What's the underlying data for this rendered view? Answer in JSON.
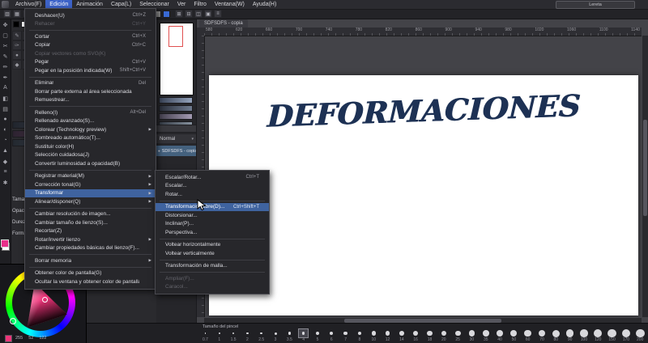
{
  "menubar": {
    "items": [
      {
        "label": "Archivo(F)"
      },
      {
        "label": "Edición",
        "active": true
      },
      {
        "label": "Animación"
      },
      {
        "label": "Capa(L)"
      },
      {
        "label": "Seleccionar"
      },
      {
        "label": "Ver"
      },
      {
        "label": "Filtro"
      },
      {
        "label": "Ventana(W)"
      },
      {
        "label": "Ayuda(H)"
      }
    ]
  },
  "window_badge": {
    "label": "Lereta"
  },
  "toolbar": {
    "left_icons": [
      "▥",
      "▦",
      "↶",
      "↷",
      "✚",
      "✖"
    ],
    "colors": [
      "#e8308a",
      "#00b7c3",
      "#2b3a8f",
      "#19a15f",
      "#c3d22b",
      "#e8a13a",
      "#d23b2f",
      "#111111",
      "#f2f2f2",
      "#7a4fd0",
      "#888888",
      "#3a6ad4"
    ],
    "right_icons": [
      "⊞",
      "⊟",
      "◫",
      "▣",
      "≡"
    ]
  },
  "tool_strip": {
    "icons": [
      "✥",
      "▢",
      "✂",
      "✎",
      "✏",
      "✒",
      "A",
      "◧",
      "▤",
      "●",
      "◐",
      "◔",
      "▲",
      "◆",
      "≡",
      "✱"
    ],
    "fg_color": "#e8308a",
    "bg_color": "#ffffff"
  },
  "palette_chips": [
    "#000000",
    "#ffffff",
    "#e8308a",
    "#5b8def",
    "#49b675",
    "#f2c14e",
    "#d95040",
    "#8a5cd6",
    "#777777",
    "#c9c9c9"
  ],
  "panel_tools": [
    "✎",
    "✏",
    "✒",
    "✑",
    "✂",
    "✱",
    "●",
    "◐",
    "▲",
    "◆",
    "▧",
    "▨"
  ],
  "tool_props": {
    "rows": [
      {
        "label": "Tamaño de pincel"
      },
      {
        "label": "Opacidad"
      },
      {
        "label": "Dureza"
      },
      {
        "label": "Forma"
      }
    ]
  },
  "layers": {
    "blend_label": "Normal",
    "items": [
      {
        "name": "SDFSDFS - copia",
        "selected": true
      }
    ]
  },
  "doc_tab": {
    "label": "SDFSDFS - copia"
  },
  "ruler": {
    "numbers": [
      "580",
      "620",
      "660",
      "700",
      "740",
      "780",
      "820",
      "860",
      "900",
      "940",
      "980",
      "1020",
      "1060",
      "1100",
      "1140"
    ]
  },
  "canvas": {
    "title": "DEFORMACIONES"
  },
  "edit_menu": {
    "items": [
      {
        "label": "Deshacer(U)",
        "shortcut": "Ctrl+Z"
      },
      {
        "label": "Rehacer",
        "shortcut": "Ctrl+Y",
        "disabled": true
      },
      {
        "type": "separator"
      },
      {
        "label": "Cortar",
        "shortcut": "Ctrl+X"
      },
      {
        "label": "Copiar",
        "shortcut": "Ctrl+C"
      },
      {
        "label": "Copiar vectores como SVG(K)",
        "disabled": true
      },
      {
        "label": "Pegar",
        "shortcut": "Ctrl+V"
      },
      {
        "label": "Pegar en la posición indicada(W)",
        "shortcut": "Shift+Ctrl+V"
      },
      {
        "type": "separator"
      },
      {
        "label": "Eliminar",
        "shortcut": "Del"
      },
      {
        "label": "Borrar parte externa al área seleccionada"
      },
      {
        "label": "Remuestrear..."
      },
      {
        "type": "separator"
      },
      {
        "label": "Relleno(I)",
        "shortcut": "Alt+Del"
      },
      {
        "label": "Rellenado avanzado(S)..."
      },
      {
        "label": "Colorear (Technology preview)",
        "arrow": "▶"
      },
      {
        "label": "Sombreado automático(T)..."
      },
      {
        "label": "Sustituir color(H)"
      },
      {
        "label": "Selección cuidadosa(J)"
      },
      {
        "label": "Convertir luminosidad a opacidad(B)"
      },
      {
        "type": "separator"
      },
      {
        "label": "Registrar material(M)",
        "arrow": "▶"
      },
      {
        "label": "Corrección tonal(G)",
        "arrow": "▶"
      },
      {
        "label": "Transformar",
        "arrow": "▶",
        "active": true
      },
      {
        "label": "Alinear/disponer(Q)",
        "arrow": "▶"
      },
      {
        "type": "separator"
      },
      {
        "label": "Cambiar resolución de imagen..."
      },
      {
        "label": "Cambiar tamaño de lienzo(S)..."
      },
      {
        "label": "Recortar(Z)"
      },
      {
        "label": "Rotar/invertir lienzo",
        "arrow": "▶"
      },
      {
        "label": "Cambiar propiedades básicas del lienzo(F)..."
      },
      {
        "type": "separator"
      },
      {
        "label": "Borrar memoria",
        "arrow": "▶"
      },
      {
        "type": "separator"
      },
      {
        "label": "Obtener color de pantalla(G)"
      },
      {
        "label": "Ocultar la ventana y obtener color de pantalla"
      }
    ]
  },
  "transform_submenu": {
    "items": [
      {
        "label": "Escalar/Rotar...",
        "shortcut": "Ctrl+T"
      },
      {
        "label": "Escalar..."
      },
      {
        "label": "Rotar..."
      },
      {
        "type": "separator"
      },
      {
        "label": "Transformación libre(D)...",
        "shortcut": "Ctrl+Shift+T",
        "active": true
      },
      {
        "label": "Distorsionar..."
      },
      {
        "label": "Inclinar(P)..."
      },
      {
        "label": "Perspectiva..."
      },
      {
        "type": "separator"
      },
      {
        "label": "Voltear horizontalmente"
      },
      {
        "label": "Voltear verticalmente"
      },
      {
        "type": "separator"
      },
      {
        "label": "Transformación de malla..."
      },
      {
        "type": "separator"
      },
      {
        "label": "Ampliar(F)...",
        "disabled": true
      },
      {
        "label": "Caracol...",
        "disabled": true
      }
    ]
  },
  "brush_palette": {
    "title": "Tamaño del pincel",
    "sizes": [
      {
        "label": "0.7"
      },
      {
        "label": "1"
      },
      {
        "label": "1.5"
      },
      {
        "label": "2"
      },
      {
        "label": "2.5"
      },
      {
        "label": "3"
      },
      {
        "label": "3.5"
      },
      {
        "label": "4",
        "selected": true
      },
      {
        "label": "5"
      },
      {
        "label": "6"
      },
      {
        "label": "7"
      },
      {
        "label": "8"
      },
      {
        "label": "10"
      },
      {
        "label": "12"
      },
      {
        "label": "14"
      },
      {
        "label": "16"
      },
      {
        "label": "18"
      },
      {
        "label": "20"
      },
      {
        "label": "25"
      },
      {
        "label": "30"
      },
      {
        "label": "35"
      },
      {
        "label": "40"
      },
      {
        "label": "50"
      },
      {
        "label": "60"
      },
      {
        "label": "70"
      },
      {
        "label": "80"
      },
      {
        "label": "90"
      },
      {
        "label": "100"
      },
      {
        "label": "120"
      },
      {
        "label": "150"
      },
      {
        "label": "170"
      },
      {
        "label": "200"
      }
    ]
  },
  "color_picker": {
    "rgb": [
      "255",
      "52",
      "122"
    ],
    "hex": "#f0347a"
  }
}
